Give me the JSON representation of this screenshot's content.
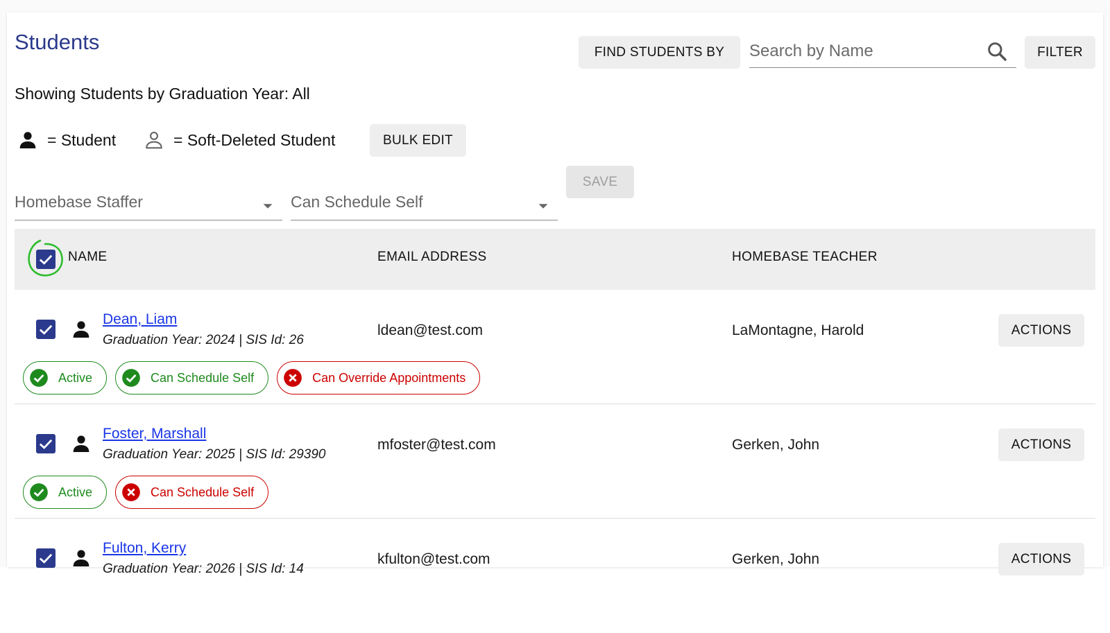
{
  "header": {
    "title": "Students",
    "find_by_label": "FIND STUDENTS BY",
    "search_placeholder": "Search by Name",
    "filter_label": "FILTER"
  },
  "subtitle": "Showing Students by Graduation Year: All",
  "legend": {
    "student": "= Student",
    "soft_deleted": "= Soft-Deleted Student",
    "bulk_edit_label": "BULK EDIT"
  },
  "bulk": {
    "homebase_staffer_label": "Homebase Staffer",
    "can_schedule_self_label": "Can Schedule Self",
    "save_label": "SAVE"
  },
  "table": {
    "columns": [
      "NAME",
      "EMAIL ADDRESS",
      "HOMEBASE TEACHER"
    ],
    "actions_label": "ACTIONS",
    "rows": [
      {
        "name": "Dean, Liam",
        "meta": "Graduation Year: 2024  |  SIS Id: 26",
        "email": "ldean@test.com",
        "teacher": "LaMontagne, Harold",
        "chips": [
          {
            "label": "Active",
            "ok": true
          },
          {
            "label": "Can Schedule Self",
            "ok": true
          },
          {
            "label": "Can Override Appointments",
            "ok": false
          }
        ]
      },
      {
        "name": "Foster, Marshall",
        "meta": "Graduation Year: 2025  |  SIS Id: 29390",
        "email": "mfoster@test.com",
        "teacher": "Gerken, John",
        "chips": [
          {
            "label": "Active",
            "ok": true
          },
          {
            "label": "Can Schedule Self",
            "ok": false
          }
        ]
      },
      {
        "name": "Fulton, Kerry",
        "meta": "Graduation Year: 2026  |  SIS Id: 14",
        "email": "kfulton@test.com",
        "teacher": "Gerken, John",
        "chips": []
      }
    ]
  },
  "colors": {
    "accent": "#2b3a8c",
    "ok": "#1e8a1e",
    "error": "#cc0000",
    "link": "#1a35e6",
    "annotation": "#2ebd2e"
  }
}
